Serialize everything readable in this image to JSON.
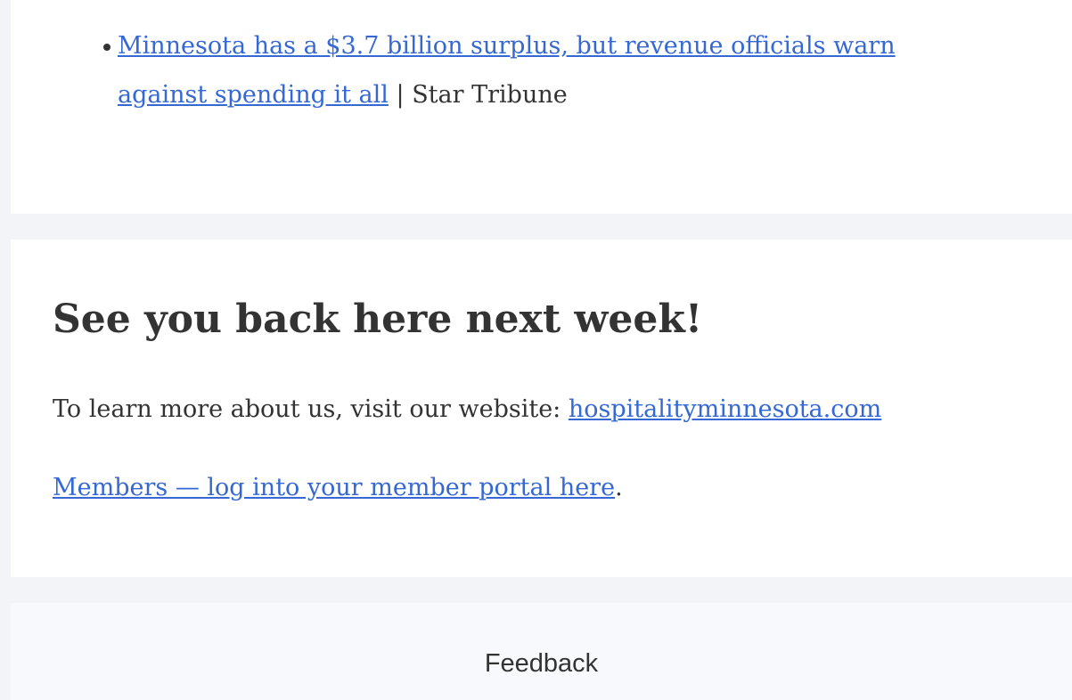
{
  "news": {
    "items": [
      {
        "link_text": "Minnesota has a $3.7 billion surplus, but revenue officials warn against spending it all",
        "separator": " | ",
        "source": "Star Tribune"
      }
    ]
  },
  "signoff": {
    "heading": "See you back here next week!",
    "website_prefix": "To learn more about us, visit our website: ",
    "website_link": "hospitalityminnesota.com",
    "portal_link": "Members — log into your member portal here",
    "portal_suffix": "."
  },
  "footer": {
    "feedback_label": "Feedback"
  },
  "colors": {
    "link": "#3568d4",
    "text": "#333333",
    "page_background": "#f3f4f8",
    "card_background": "#ffffff",
    "footer_background": "#f8f9fc"
  }
}
